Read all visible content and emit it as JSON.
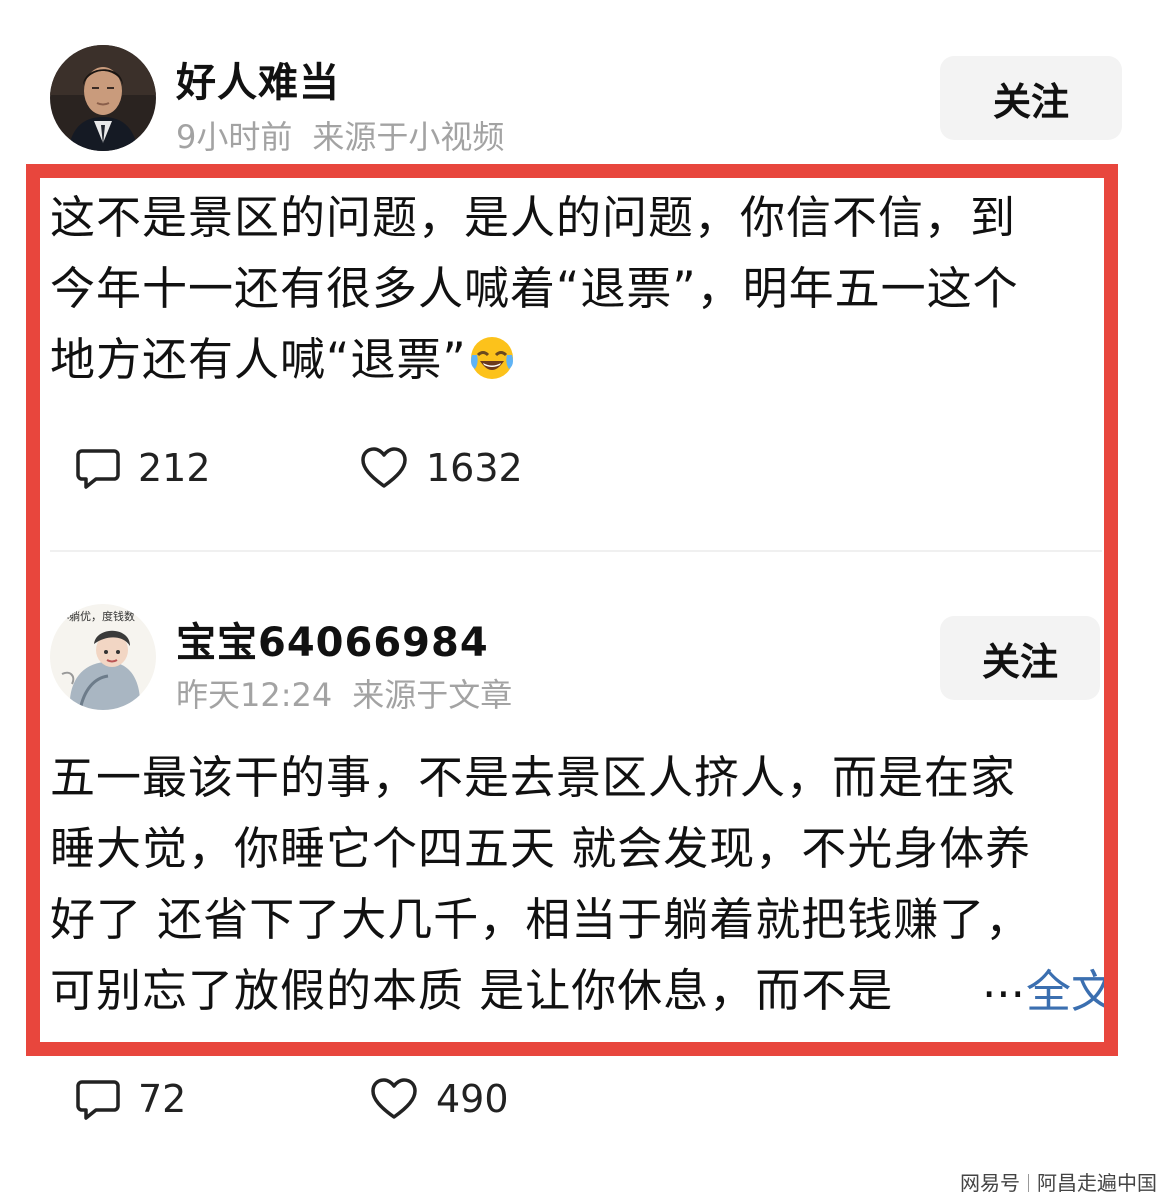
{
  "post1": {
    "username": "好人难当",
    "time": "9小时前",
    "source": "来源于小视频",
    "follow_label": "关注",
    "lines": [
      "这不是景区的问题，是人的问题，你信不信，到",
      "今年十一还有很多人喊着“退票”，明年五一这个",
      "地方还有人喊“退票”"
    ],
    "emoji_icon": "laughing-crying-emoji-icon",
    "comment_count": "212",
    "like_count": "1632"
  },
  "post2": {
    "username": "宝宝64066984",
    "time": "昨天12:24",
    "source": "来源于文章",
    "follow_label": "关注",
    "avatar_caption": "小躺优，度钱数",
    "lines": [
      "五一最该干的事，不是去景区人挤人，而是在家",
      "睡大觉，你睡它个四五天 就会发现，不光身体养",
      "好了 还省下了大几千，相当于躺着就把钱赚了，",
      "可别忘了放假的本质 是让你休息，而不是"
    ],
    "ellipsis": "...",
    "full_text_link": "全文",
    "comment_count": "72",
    "like_count": "490"
  },
  "watermark": {
    "platform": "网易号",
    "author": "阿昌走遍中国"
  },
  "colors": {
    "highlight_border": "#e8463d",
    "link": "#3b6fb0",
    "meta_text": "#a3a3a3",
    "button_bg": "#f3f3f3"
  }
}
